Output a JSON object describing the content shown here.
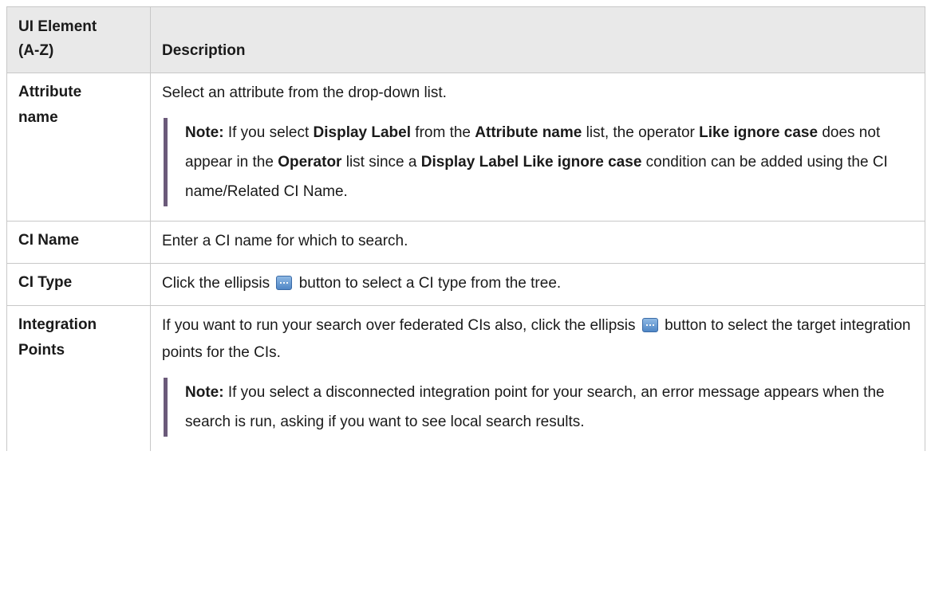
{
  "header": {
    "col1_line1": "UI Element",
    "col1_line2": "(A-Z)",
    "col2": "Description"
  },
  "rows": [
    {
      "name_line1": "Attribute",
      "name_line2": "name",
      "desc": "Select an attribute from the drop-down list.",
      "note": {
        "label": "Note:",
        "t1": " If you select ",
        "b1": "Display Label",
        "t2": " from the ",
        "b2": "Attribute name",
        "t3": " list, the operator ",
        "b3": "Like ignore case",
        "t4": " does not appear in the ",
        "b4": "Operator",
        "t5": " list since a ",
        "b5": "Display Label Like ignore case",
        "t6": " condition can be added using the CI name/Related CI Name."
      }
    },
    {
      "name": "CI Name",
      "desc": "Enter a CI name for which to search."
    },
    {
      "name": "CI Type",
      "desc_before": "Click the ellipsis",
      "desc_after": "button to select a CI type from the tree.",
      "icon": "ellipsis-button-icon"
    },
    {
      "name_line1": "Integration",
      "name_line2": "Points",
      "desc_before": "If you want to run your search over federated CIs also, click the ellipsis",
      "desc_after": "button to select the target integration points for the CIs.",
      "icon": "ellipsis-button-icon",
      "note": {
        "label": "Note:",
        "text": " If you select a disconnected integration point for your search, an error message appears when the search is run, asking if you want to see local search results."
      }
    }
  ],
  "colors": {
    "header_bg": "#e9e9e9",
    "border": "#c8c8c8",
    "note_bar": "#6b5a7a",
    "icon_blue": "#4f86c6"
  }
}
